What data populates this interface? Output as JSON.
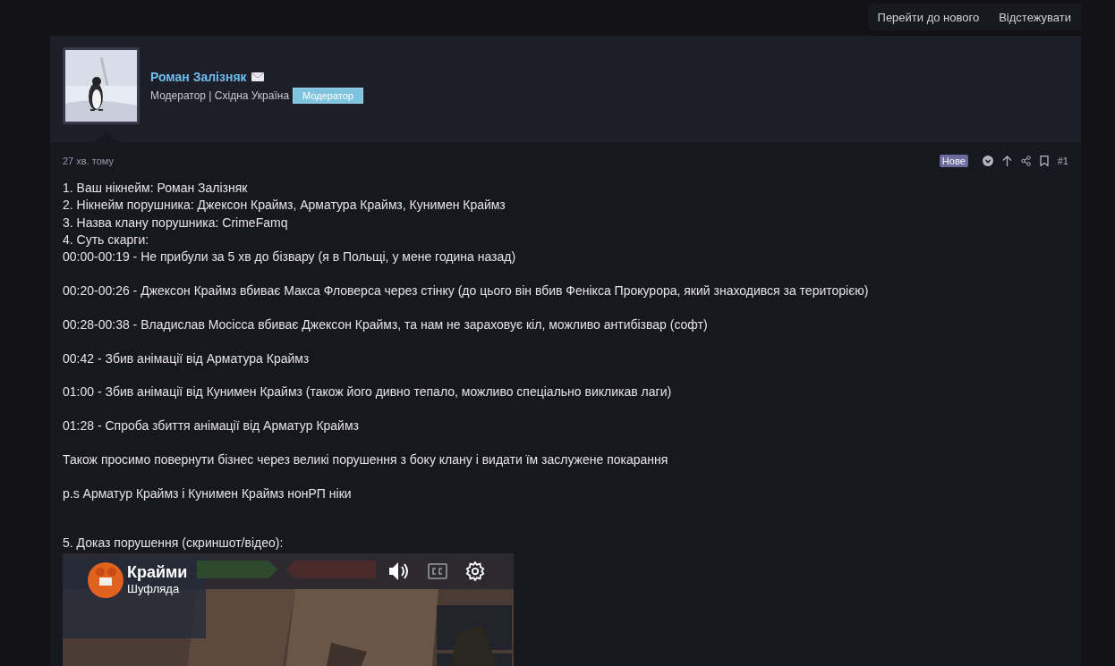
{
  "top_actions": [
    "Перейти до нового",
    "Відстежувати"
  ],
  "author": {
    "name": "Роман Залізняк",
    "subtitle": "Модератор | Східна Україна",
    "badge": "Модератор"
  },
  "post": {
    "time": "27 хв. тому",
    "new_badge": "Нове",
    "number": "#1",
    "blocks": [
      [
        "1. Ваш нікнейм: Роман Залізняк",
        "2. Нікнейм порушника: Джексон Краймз, Арматура Краймз, Кунимен Краймз",
        "3. Назва клану порушника: CrimeFamq",
        "4. Суть скарги:",
        "00:00-00:19 - Не прибули за 5 хв до бізвару (я в Польщі, у мене година назад)"
      ],
      [
        "00:20-00:26 - Джексон Краймз вбиває Макса Фловерса через стінку (до цього він вбив Фенікса Прокурора, який знаходився за територією)"
      ],
      [
        "00:28-00:38 - Владислав Мосісса вбиває Джексон Краймз, та нам не зараховує кіл, можливо антибізвар (софт)"
      ],
      [
        "00:42 - Збив анімації від Арматура Краймз"
      ],
      [
        "01:00 - Збив анімації від Кунимен Краймз (також його дивно тепало, можливо спеціально викликав лаги)"
      ],
      [
        "01:28 - Спроба збиття анімації від Арматур Краймз"
      ],
      [
        "Також просимо повернути бізнес через великі порушення з боку клану і видати їм заслужене покарання"
      ],
      [
        "p.s Арматур Краймз і Кунимен Краймз нонРП ніки"
      ]
    ],
    "evidence_label": "5. Доказ порушення (скриншот/відео):",
    "video": {
      "title": "Крайми",
      "channel": "Шуфляда"
    }
  }
}
